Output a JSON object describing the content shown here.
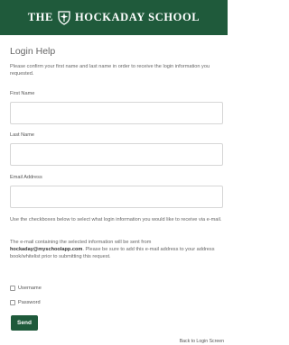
{
  "header": {
    "brand_left": "THE",
    "brand_right": "HOCKADAY SCHOOL",
    "logo_icon": "school-crest-icon",
    "background_color": "#1f5a3b"
  },
  "title": "Login Help",
  "intro": "Please confirm your first name and last name in order to receive the login information you requested.",
  "fields": {
    "first_name_label": "First Name",
    "first_name_value": "",
    "last_name_label": "Last Name",
    "last_name_value": "",
    "email_label": "Email Address",
    "email_value": ""
  },
  "instructions": "Use the checkboxes below to select what login information you would like to receive via e-mail.",
  "email_note": {
    "before": "The e-mail containing the selected information will be sent from ",
    "sender": "hockaday@myschoolapp.com",
    "after": ". Please be sure to add this e-mail address to your address book/whitelist prior to submitting this request."
  },
  "options": [
    {
      "label": "Username",
      "checked": false
    },
    {
      "label": "Password",
      "checked": false
    }
  ],
  "send_label": "Send",
  "back_link": "Back to Login Screen"
}
